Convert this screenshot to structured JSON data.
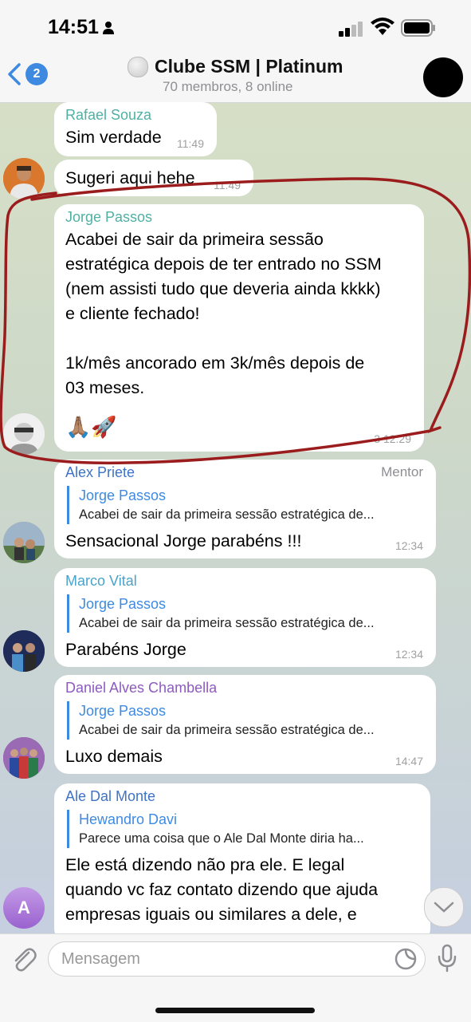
{
  "status_bar": {
    "time": "14:51"
  },
  "header": {
    "back_count": "2",
    "title": "Clube SSM | Platinum",
    "subtitle": "70 membros, 8 online"
  },
  "messages": [
    {
      "sender": "Rafael Souza",
      "text": "Sim verdade",
      "time": "11:49",
      "sender_color": "#4fb0a3"
    },
    {
      "text": "Sugeri aqui hehe",
      "time": "11:49"
    },
    {
      "sender": "Jorge Passos",
      "text_lines": [
        "Acabei de sair da primeira sessão",
        "estratégica depois de ter entrado no SSM",
        "(nem assisti tudo que deveria ainda kkkk)",
        "e cliente fechado!",
        "",
        "1k/mês ancorado em 3k/mês depois de",
        "03 meses."
      ],
      "emoji": "🙏🏽🚀",
      "time": "3  12:29",
      "sender_color": "#4fb0a3"
    },
    {
      "sender": "Alex Priete",
      "tag": "Mentor",
      "quote_name": "Jorge Passos",
      "quote_text": "Acabei de sair da primeira sessão estratégica de...",
      "text": "Sensacional Jorge parabéns !!!",
      "time": "12:34",
      "sender_color": "#3e73c9"
    },
    {
      "sender": "Marco Vital",
      "quote_name": "Jorge Passos",
      "quote_text": "Acabei de sair da primeira sessão estratégica de...",
      "text": "Parabéns Jorge",
      "time": "12:34",
      "sender_color": "#4aa3c9"
    },
    {
      "sender": "Daniel Alves Chambella",
      "quote_name": "Jorge Passos",
      "quote_text": "Acabei de sair da primeira sessão estratégica de...",
      "text": "Luxo demais",
      "time": "14:47",
      "sender_color": "#8d5bbf"
    },
    {
      "sender": "Ale Dal Monte",
      "quote_name": "Hewandro Davi",
      "quote_text": "Parece uma coisa que o Ale Dal Monte diria ha...",
      "text_lines": [
        "Ele está dizendo não pra ele. E legal",
        "quando vc faz contato dizendo que ajuda",
        "empresas iguais ou similares a dele, e"
      ],
      "sender_color": "#3e73c9"
    }
  ],
  "avatars": {
    "ale_initial": "A"
  },
  "input": {
    "placeholder": "Mensagem"
  },
  "colors": {
    "accent": "#3e8ae1",
    "annotation": "#9b1c1c"
  }
}
